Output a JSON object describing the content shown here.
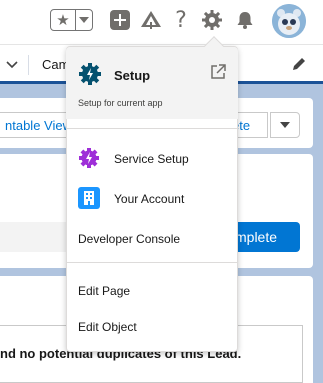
{
  "header": {
    "favorites_star": "★",
    "icons": [
      "star-icon",
      "chevron-down-icon",
      "add-icon",
      "trailhead-icon",
      "help-icon",
      "gear-icon",
      "bell-icon",
      "avatar"
    ]
  },
  "navbar": {
    "tab_label": "Cam"
  },
  "background": {
    "list_view_button": "ntable View",
    "ete_button": "ete",
    "complete_button": "mplete",
    "duplicates_text": "nd no potential duplicates of this Lead."
  },
  "setup_menu": {
    "title": "Setup",
    "subtitle": "Setup for current app",
    "items": [
      {
        "label": "Service Setup",
        "icon": "service-setup-icon"
      },
      {
        "label": "Your Account",
        "icon": "account-icon"
      },
      {
        "label": "Developer Console"
      },
      {
        "label": "Edit Page"
      },
      {
        "label": "Edit Object"
      }
    ]
  },
  "colors": {
    "brand_blue": "#0176d3",
    "setup_icon": "#04516f",
    "service_purple": "#9e2fd8",
    "account_blue": "#1b96ff",
    "nav_underline": "#1b5297",
    "page_background": "#b0c4df"
  }
}
